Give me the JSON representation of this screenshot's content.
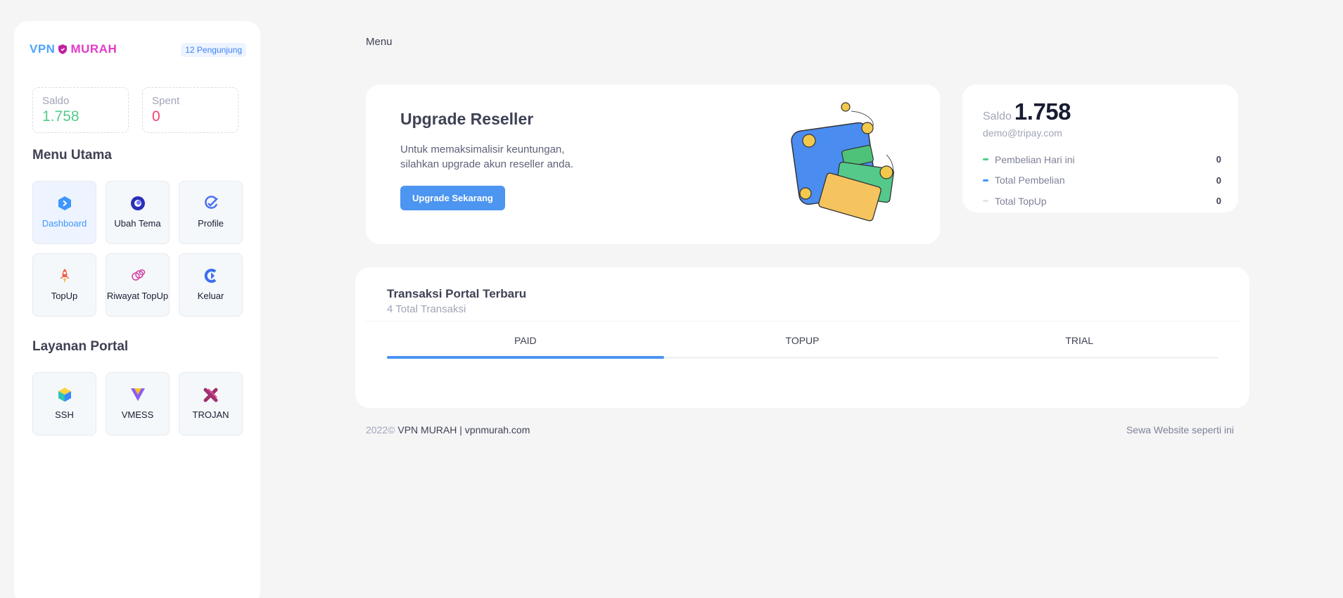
{
  "sidebar": {
    "brand_left": "VPN",
    "brand_right": "MURAH",
    "visitors": "12 Pengunjung",
    "stats": {
      "saldo_label": "Saldo",
      "saldo_value": "1.758",
      "spent_label": "Spent",
      "spent_value": "0"
    },
    "menu_title": "Menu Utama",
    "menu_items": [
      {
        "label": "Dashboard",
        "icon": "dashboard-icon",
        "active": true
      },
      {
        "label": "Ubah Tema",
        "icon": "theme-icon"
      },
      {
        "label": "Profile",
        "icon": "profile-icon"
      },
      {
        "label": "TopUp",
        "icon": "rocket-icon"
      },
      {
        "label": "Riwayat TopUp",
        "icon": "history-icon"
      },
      {
        "label": "Keluar",
        "icon": "logout-icon"
      }
    ],
    "portal_title": "Layanan Portal",
    "portal_items": [
      {
        "label": "SSH",
        "icon": "cube-icon"
      },
      {
        "label": "VMESS",
        "icon": "vmess-icon"
      },
      {
        "label": "TROJAN",
        "icon": "trojan-icon"
      }
    ]
  },
  "header": {
    "crumb": "Menu"
  },
  "upgrade": {
    "title": "Upgrade Reseller",
    "line1": "Untuk memaksimalisir keuntungan,",
    "line2": "silahkan upgrade akun reseller anda.",
    "button": "Upgrade Sekarang"
  },
  "balance": {
    "label": "Saldo",
    "value": "1.758",
    "email": "demo@tripay.com",
    "rows": [
      {
        "name": "Pembelian Hari ini",
        "value": "0",
        "color": "#50cd89"
      },
      {
        "name": "Total Pembelian",
        "value": "0",
        "color": "#3e97ff"
      },
      {
        "name": "Total TopUp",
        "value": "0",
        "color": "#e4e6ef"
      }
    ]
  },
  "transactions": {
    "title": "Transaksi Portal Terbaru",
    "subtitle": "4 Total Transaksi",
    "tabs": [
      "PAID",
      "TOPUP",
      "TRIAL"
    ],
    "active_tab": "PAID"
  },
  "footer": {
    "year": "2022©",
    "site": "VPN MURAH | vpnmurah.com",
    "right": "Sewa Website seperti ini"
  },
  "colors": {
    "accent": "#4c95f0",
    "success": "#50cd89",
    "danger": "#f1416c",
    "brand_blue": "#4ea3ff",
    "brand_pink": "#e23cc8"
  }
}
